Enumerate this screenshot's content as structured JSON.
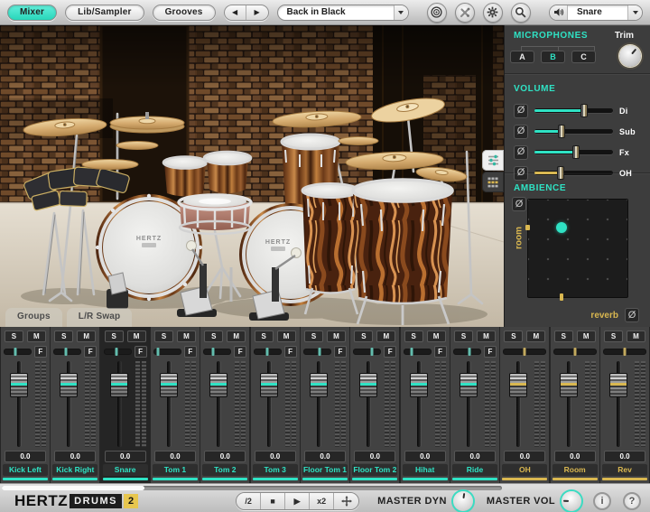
{
  "colors": {
    "teal": "#2fe2c4",
    "yellow": "#d9b750"
  },
  "toolbar": {
    "mixer_btn": "Mixer",
    "lib_btn": "Lib/Sampler",
    "grooves_btn": "Grooves",
    "prev": "◀",
    "next": "▶",
    "song_select": "Back in Black",
    "instrument_select": "Snare"
  },
  "panel": {
    "microphones": {
      "title": "MICROPHONES",
      "trim": "Trim",
      "mics": [
        "A",
        "B",
        "C"
      ],
      "active_mic": "B"
    },
    "volume": {
      "title": "VOLUME",
      "phase_symbol": "Ø",
      "rows": [
        {
          "label": "Di",
          "pct": 63,
          "color": "teal"
        },
        {
          "label": "Sub",
          "pct": 35,
          "color": "teal"
        },
        {
          "label": "Fx",
          "pct": 53,
          "color": "teal"
        },
        {
          "label": "OH",
          "pct": 33,
          "color": "yellow"
        }
      ]
    },
    "ambience": {
      "title": "AMBIENCE",
      "y_label": "room",
      "x_label": "reverb",
      "phase_symbol": "Ø",
      "dot": {
        "x_pct": 34,
        "y_pct": 29
      }
    }
  },
  "stage": {
    "groups_tab": "Groups",
    "lr_swap_tab": "L/R Swap",
    "drum_logo": "HERTZ"
  },
  "mixer": {
    "solo": "S",
    "mute": "M",
    "fx": "F",
    "channels": [
      {
        "name": "Kick Left",
        "value": "0.0",
        "accent": "teal",
        "has_f": true,
        "pan_pct": 40,
        "selected": false
      },
      {
        "name": "Kick Right",
        "value": "0.0",
        "accent": "teal",
        "has_f": true,
        "pan_pct": 45,
        "selected": false
      },
      {
        "name": "Snare",
        "value": "0.0",
        "accent": "teal",
        "has_f": true,
        "pan_pct": 45,
        "selected": true
      },
      {
        "name": "Tom 1",
        "value": "0.0",
        "accent": "teal",
        "has_f": true,
        "pan_pct": 15,
        "selected": false
      },
      {
        "name": "Tom 2",
        "value": "0.0",
        "accent": "teal",
        "has_f": true,
        "pan_pct": 35,
        "selected": false
      },
      {
        "name": "Tom 3",
        "value": "0.0",
        "accent": "teal",
        "has_f": true,
        "pan_pct": 50,
        "selected": false
      },
      {
        "name": "Floor Tom 1",
        "value": "0.0",
        "accent": "teal",
        "has_f": true,
        "pan_pct": 60,
        "selected": false
      },
      {
        "name": "Floor Tom 2",
        "value": "0.0",
        "accent": "teal",
        "has_f": true,
        "pan_pct": 68,
        "selected": false
      },
      {
        "name": "Hihat",
        "value": "0.0",
        "accent": "teal",
        "has_f": true,
        "pan_pct": 30,
        "selected": false
      },
      {
        "name": "Ride",
        "value": "0.0",
        "accent": "teal",
        "has_f": true,
        "pan_pct": 58,
        "selected": false
      },
      {
        "name": "OH",
        "value": "0.0",
        "accent": "yellow",
        "has_f": false,
        "pan_pct": 50,
        "selected": false
      },
      {
        "name": "Room",
        "value": "0.0",
        "accent": "yellow",
        "has_f": false,
        "pan_pct": 50,
        "selected": false
      },
      {
        "name": "Rev",
        "value": "0.0",
        "accent": "yellow",
        "has_f": false,
        "pan_pct": 50,
        "selected": false
      }
    ]
  },
  "bottom": {
    "logo_hertz": "HERTZ",
    "logo_drums": "DRUMS",
    "logo_num": "2",
    "transport": {
      "half": "/2",
      "stop": "■",
      "play": "▶",
      "double": "x2"
    },
    "master_dyn": "MASTER DYN",
    "master_vol": "MASTER VOL",
    "info": "i",
    "help": "?"
  }
}
